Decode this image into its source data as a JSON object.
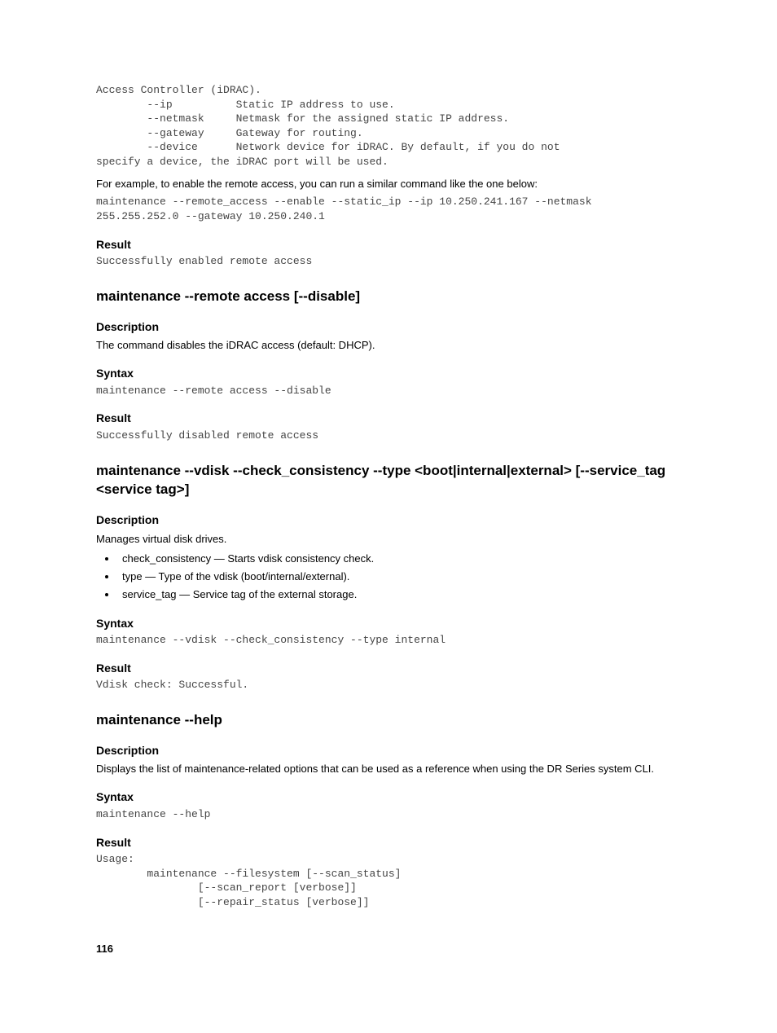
{
  "codeblock_top": "Access Controller (iDRAC).\n        --ip          Static IP address to use.\n        --netmask     Netmask for the assigned static IP address.\n        --gateway     Gateway for routing.\n        --device      Network device for iDRAC. By default, if you do not\nspecify a device, the iDRAC port will be used.",
  "example_intro": "For example, to enable the remote access, you can run a similar command like the one below:",
  "example_cmd": "maintenance --remote_access --enable --static_ip --ip 10.250.241.167 --netmask\n255.255.252.0 --gateway 10.250.240.1",
  "result_heading": "Result",
  "result_enable": "Successfully enabled remote access",
  "disable": {
    "title": "maintenance --remote access [--disable]",
    "desc_h": "Description",
    "desc_t": "The command disables the iDRAC access (default: DHCP).",
    "syntax_h": "Syntax",
    "syntax_t": "maintenance --remote access --disable",
    "result_h": "Result",
    "result_t": "Successfully disabled remote access"
  },
  "vdisk": {
    "title": "maintenance --vdisk --check_consistency --type <boot|internal|external> [--service_tag <service tag>]",
    "desc_h": "Description",
    "desc_t": "Manages virtual disk drives.",
    "bullets": [
      "check_consistency — Starts vdisk consistency check.",
      "type — Type of the vdisk (boot/internal/external).",
      "service_tag — Service tag of the external storage."
    ],
    "syntax_h": "Syntax",
    "syntax_t": "maintenance --vdisk --check_consistency --type internal",
    "result_h": "Result",
    "result_t": "Vdisk check: Successful."
  },
  "help": {
    "title": "maintenance --help",
    "desc_h": "Description",
    "desc_t": "Displays the list of maintenance-related options that can be used as a reference when using the DR Series system CLI.",
    "syntax_h": "Syntax",
    "syntax_t": "maintenance --help",
    "result_h": "Result",
    "result_t": "Usage:\n        maintenance --filesystem [--scan_status]\n                [--scan_report [verbose]]\n                [--repair_status [verbose]]"
  },
  "page_number": "116"
}
